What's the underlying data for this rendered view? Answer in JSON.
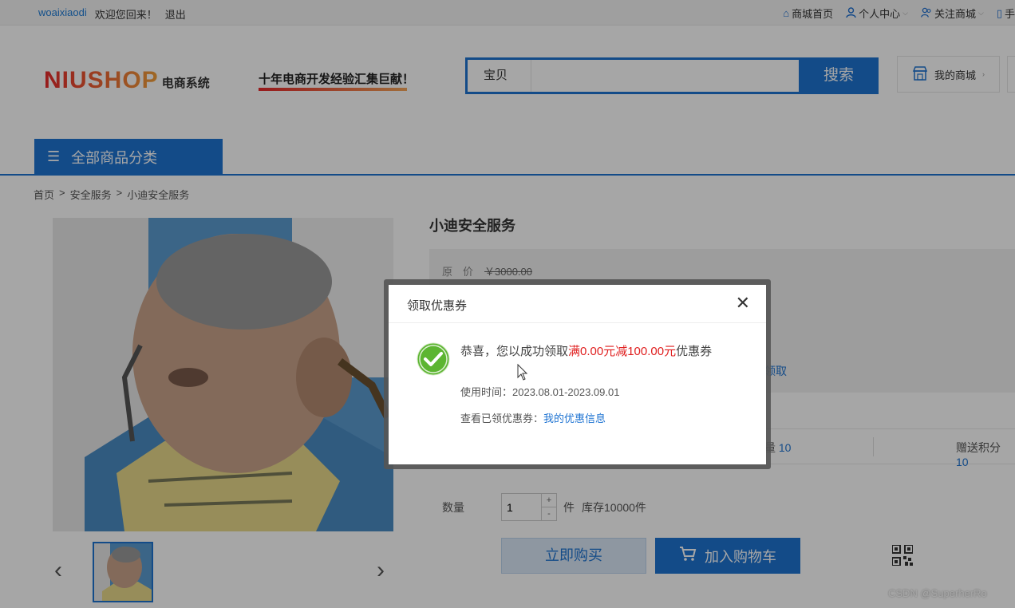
{
  "topbar": {
    "username": "woaixiaodi",
    "welcome": "欢迎您回来！",
    "logout": "退出",
    "home": "商城首页",
    "personal": "个人中心",
    "follow": "关注商城",
    "mobile": "手"
  },
  "header": {
    "brand": "NIUSHOP",
    "brand_sub": "电商系统",
    "slogan": "十年电商开发经验汇集巨献！",
    "search_tag": "宝贝",
    "search_button": "搜索",
    "my_store": "我的商城"
  },
  "nav": {
    "all_categories": "全部商品分类"
  },
  "breadcrumb": [
    "首页",
    "安全服务",
    "小迪安全服务"
  ],
  "product": {
    "title": "小迪安全服务",
    "original_price_label": "原　价",
    "original_price": "￥3000.00",
    "receive_link": "领取",
    "stat1_label": "量",
    "stat1_value": "10",
    "stat2_label": "赠送积分",
    "stat2_value": "10",
    "qty_label": "数量",
    "qty_value": "1",
    "qty_plus": "+",
    "qty_minus": "-",
    "unit": "件",
    "stock": "库存10000件",
    "buy_now": "立即购买",
    "add_to_cart": "加入购物车"
  },
  "modal": {
    "title": "领取优惠券",
    "msg_prefix": "恭喜，您以成功领取",
    "msg_coupon": "满0.00元减100.00元",
    "msg_suffix": "优惠券",
    "use_time": "使用时间：2023.08.01-2023.09.01",
    "view_prefix": "查看已领优惠券：",
    "view_link": "我的优惠信息"
  },
  "watermark": "CSDN @SuperherRo",
  "colors": {
    "accent": "#1e73d2",
    "coupon_red": "#e02020",
    "success_green": "#5cb531"
  }
}
